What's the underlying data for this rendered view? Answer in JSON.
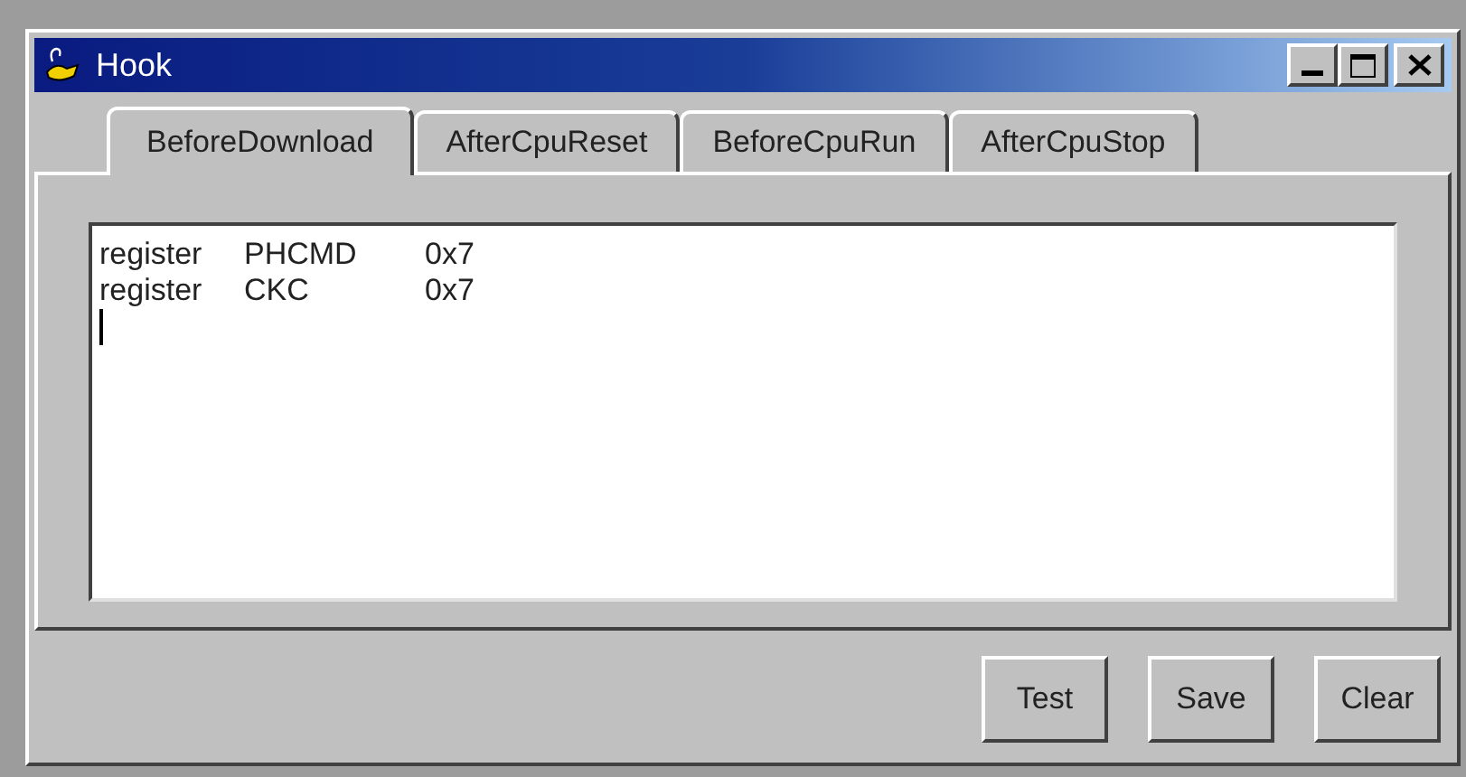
{
  "window": {
    "title": "Hook"
  },
  "tabs": [
    {
      "label": "BeforeDownload",
      "selected": true
    },
    {
      "label": "AfterCpuReset",
      "selected": false
    },
    {
      "label": "BeforeCpuRun",
      "selected": false
    },
    {
      "label": "AfterCpuStop",
      "selected": false
    }
  ],
  "editor": {
    "lines": [
      {
        "keyword": "register",
        "name": "PHCMD",
        "value": "0x7"
      },
      {
        "keyword": "register",
        "name": "CKC",
        "value": "0x7"
      }
    ]
  },
  "buttons": [
    "Test",
    "Save",
    "Clear"
  ]
}
